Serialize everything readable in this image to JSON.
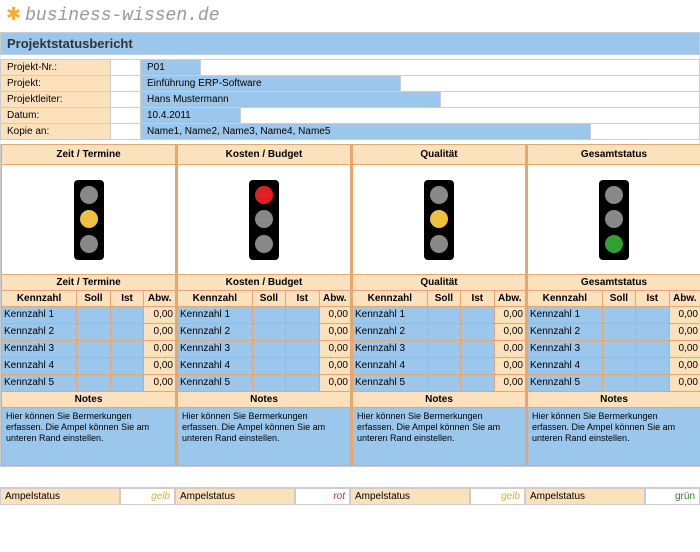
{
  "brand": "business-wissen.de",
  "title": "Projektstatusbericht",
  "meta": {
    "nr_label": "Projekt-Nr.:",
    "nr_value": "P01",
    "project_label": "Projekt:",
    "project_value": "Einführung ERP-Software",
    "lead_label": "Projektleiter:",
    "lead_value": "Hans Mustermann",
    "date_label": "Datum:",
    "date_value": "10.4.2011",
    "copy_label": "Kopie an:",
    "copy_value": "Name1, Name2, Name3, Name4, Name5"
  },
  "columns": {
    "kennzahl": "Kennzahl",
    "soll": "Soll",
    "ist": "Ist",
    "abw": "Abw."
  },
  "notes_label": "Notes",
  "notes_text": "Hier können Sie Bermerkungen erfassen. Die Ampel können Sie am unteren Rand einstellen.",
  "footer_label": "Ampelstatus",
  "sections": [
    {
      "title": "Zeit / Termine",
      "light": "yellow",
      "status_text": "gelb",
      "status_class": "st-gelb",
      "kpis": [
        {
          "name": "Kennzahl 1",
          "soll": "",
          "ist": "",
          "abw": "0,00"
        },
        {
          "name": "Kennzahl 2",
          "soll": "",
          "ist": "",
          "abw": "0,00"
        },
        {
          "name": "Kennzahl 3",
          "soll": "",
          "ist": "",
          "abw": "0,00"
        },
        {
          "name": "Kennzahl 4",
          "soll": "",
          "ist": "",
          "abw": "0,00"
        },
        {
          "name": "Kennzahl 5",
          "soll": "",
          "ist": "",
          "abw": "0,00"
        }
      ]
    },
    {
      "title": "Kosten / Budget",
      "light": "red",
      "status_text": "rot",
      "status_class": "st-rot",
      "kpis": [
        {
          "name": "Kennzahl 1",
          "soll": "",
          "ist": "",
          "abw": "0,00"
        },
        {
          "name": "Kennzahl 2",
          "soll": "",
          "ist": "",
          "abw": "0,00"
        },
        {
          "name": "Kennzahl 3",
          "soll": "",
          "ist": "",
          "abw": "0,00"
        },
        {
          "name": "Kennzahl 4",
          "soll": "",
          "ist": "",
          "abw": "0,00"
        },
        {
          "name": "Kennzahl 5",
          "soll": "",
          "ist": "",
          "abw": "0,00"
        }
      ]
    },
    {
      "title": "Qualität",
      "light": "yellow",
      "status_text": "gelb",
      "status_class": "st-gelb",
      "kpis": [
        {
          "name": "Kennzahl 1",
          "soll": "",
          "ist": "",
          "abw": "0,00"
        },
        {
          "name": "Kennzahl 2",
          "soll": "",
          "ist": "",
          "abw": "0,00"
        },
        {
          "name": "Kennzahl 3",
          "soll": "",
          "ist": "",
          "abw": "0,00"
        },
        {
          "name": "Kennzahl 4",
          "soll": "",
          "ist": "",
          "abw": "0,00"
        },
        {
          "name": "Kennzahl 5",
          "soll": "",
          "ist": "",
          "abw": "0,00"
        }
      ]
    },
    {
      "title": "Gesamtstatus",
      "light": "green",
      "status_text": "grün",
      "status_class": "st-gruen",
      "kpis": [
        {
          "name": "Kennzahl 1",
          "soll": "",
          "ist": "",
          "abw": "0,00"
        },
        {
          "name": "Kennzahl 2",
          "soll": "",
          "ist": "",
          "abw": "0,00"
        },
        {
          "name": "Kennzahl 3",
          "soll": "",
          "ist": "",
          "abw": "0,00"
        },
        {
          "name": "Kennzahl 4",
          "soll": "",
          "ist": "",
          "abw": "0,00"
        },
        {
          "name": "Kennzahl 5",
          "soll": "",
          "ist": "",
          "abw": "0,00"
        }
      ]
    }
  ]
}
